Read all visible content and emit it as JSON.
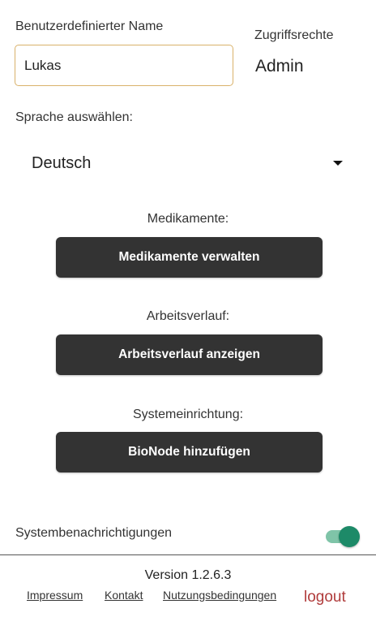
{
  "profile": {
    "name_label": "Benutzerdefinierter Name",
    "name_value": "Lukas",
    "rights_label": "Zugriffsrechte",
    "rights_value": "Admin"
  },
  "language": {
    "label": "Sprache auswählen:",
    "selected": "Deutsch",
    "icon": "caret-down-icon"
  },
  "sections": {
    "medications": {
      "label": "Medikamente:",
      "button": "Medikamente verwalten"
    },
    "work_history": {
      "label": "Arbeitsverlauf:",
      "button": "Arbeitsverlauf anzeigen"
    },
    "system_setup": {
      "label": "Systemeinrichtung:",
      "button": "BioNode hinzufügen"
    }
  },
  "notifications": {
    "label": "Systembenachrichtigungen",
    "enabled": true
  },
  "footer": {
    "version": "Version 1.2.6.3",
    "links": [
      "Impressum",
      "Kontakt",
      "Nutzungsbedingungen"
    ],
    "logout": "logout"
  },
  "colors": {
    "button_bg": "#333333",
    "input_border": "#d9b16a",
    "toggle_on": "#1d8a68",
    "logout": "#b03b3b"
  }
}
